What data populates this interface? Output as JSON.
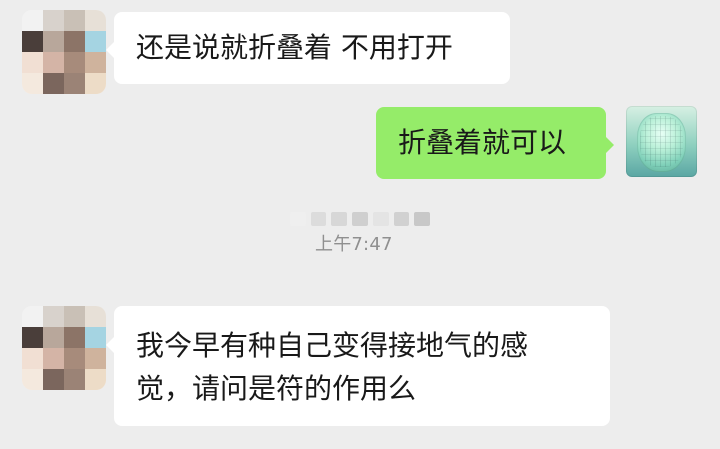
{
  "chat": {
    "messages": [
      {
        "id": "msg1",
        "text": "还是说就折叠着 不用打开"
      },
      {
        "id": "msg2",
        "text": "折叠着就可以"
      },
      {
        "id": "msg3",
        "text": "我今早有种自己变得接地气的感\n觉，请问是符的作用么"
      }
    ],
    "timestamp": "上午7:47"
  },
  "colors": {
    "background": "#ededed",
    "incoming_bubble": "#ffffff",
    "outgoing_bubble": "#95ec69",
    "timestamp_text": "#8f8f8f"
  },
  "icons": {
    "left_avatar": "pixelated-avatar",
    "right_avatar": "green-face-avatar"
  }
}
